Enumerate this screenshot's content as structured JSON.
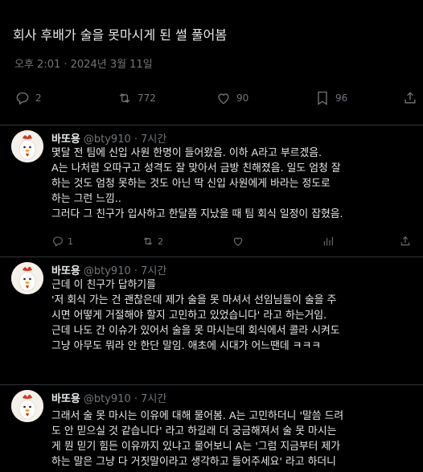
{
  "post": {
    "title": "회사 후배가 술을 못마시게 된 썰 풀어봄",
    "timestamp": "오후 2:01 · 2024년 3월 11일",
    "stats": {
      "replies": "2",
      "retweets": "772",
      "likes": "90",
      "views": "96"
    }
  },
  "replies": [
    {
      "name": "바또용",
      "handle": "@bty910 · 7시간",
      "lines": [
        "몇달 전 팀에 신입 사원 한명이 들어왔음. 이하 A라고 부르겠음.",
        "A는 나처럼 오따구고 성격도 잘 맞아서 금방 친해졌음. 일도 엄청 잘",
        "하는 것도 엄청 못하는 것도 아닌 딱 신입 사원에게 바라는 정도로",
        "하는 그런 느낌..",
        "그러다 그 친구가 입사하고 한달쯤 지났을 때 팀 회식 일정이 잡혔음."
      ],
      "actions": {
        "replies": "1",
        "retweets": "2"
      }
    },
    {
      "name": "바또용",
      "handle": "@bty910 · 7시간",
      "lines": [
        "근데 이 친구가 답하기를",
        "'저 회식 가는 건 괜찮은데 제가 술을 못 마셔서 선임님들이 술을 주",
        "시면 어떻게 거절해야 할지 고민하고 있었습니다' 라고 하는거임.",
        "근데 나도 간 이슈가 있어서 술을 못 마시는데 회식에서 콜라 시켜도",
        "그냥 아무도 뭐라 안 한단 말임. 애초에 시대가 어느땐데 ㅋㅋㅋ"
      ],
      "actions": {
        "replies": "",
        "retweets": ""
      }
    },
    {
      "name": "바또용",
      "handle": "@bty910 · 7시간",
      "lines": [
        "그래서 술 못 마시는 이유에 대해 물어봄. A는 고민하더니 '말씀 드려",
        "도 안 믿으실 것 같습니다' 라고 하길래 더 궁금해져서 술 못 마시는",
        "게 뭔 믿기 힘든 이유까지 있냐고 물어보니 A는 '그럼 지금부터 제가",
        "하는 말은 그냥 다 거짓말이라고 생각하고 들어주세요' 라고 하더니"
      ],
      "actions": {
        "replies": "",
        "retweets": ""
      }
    }
  ]
}
